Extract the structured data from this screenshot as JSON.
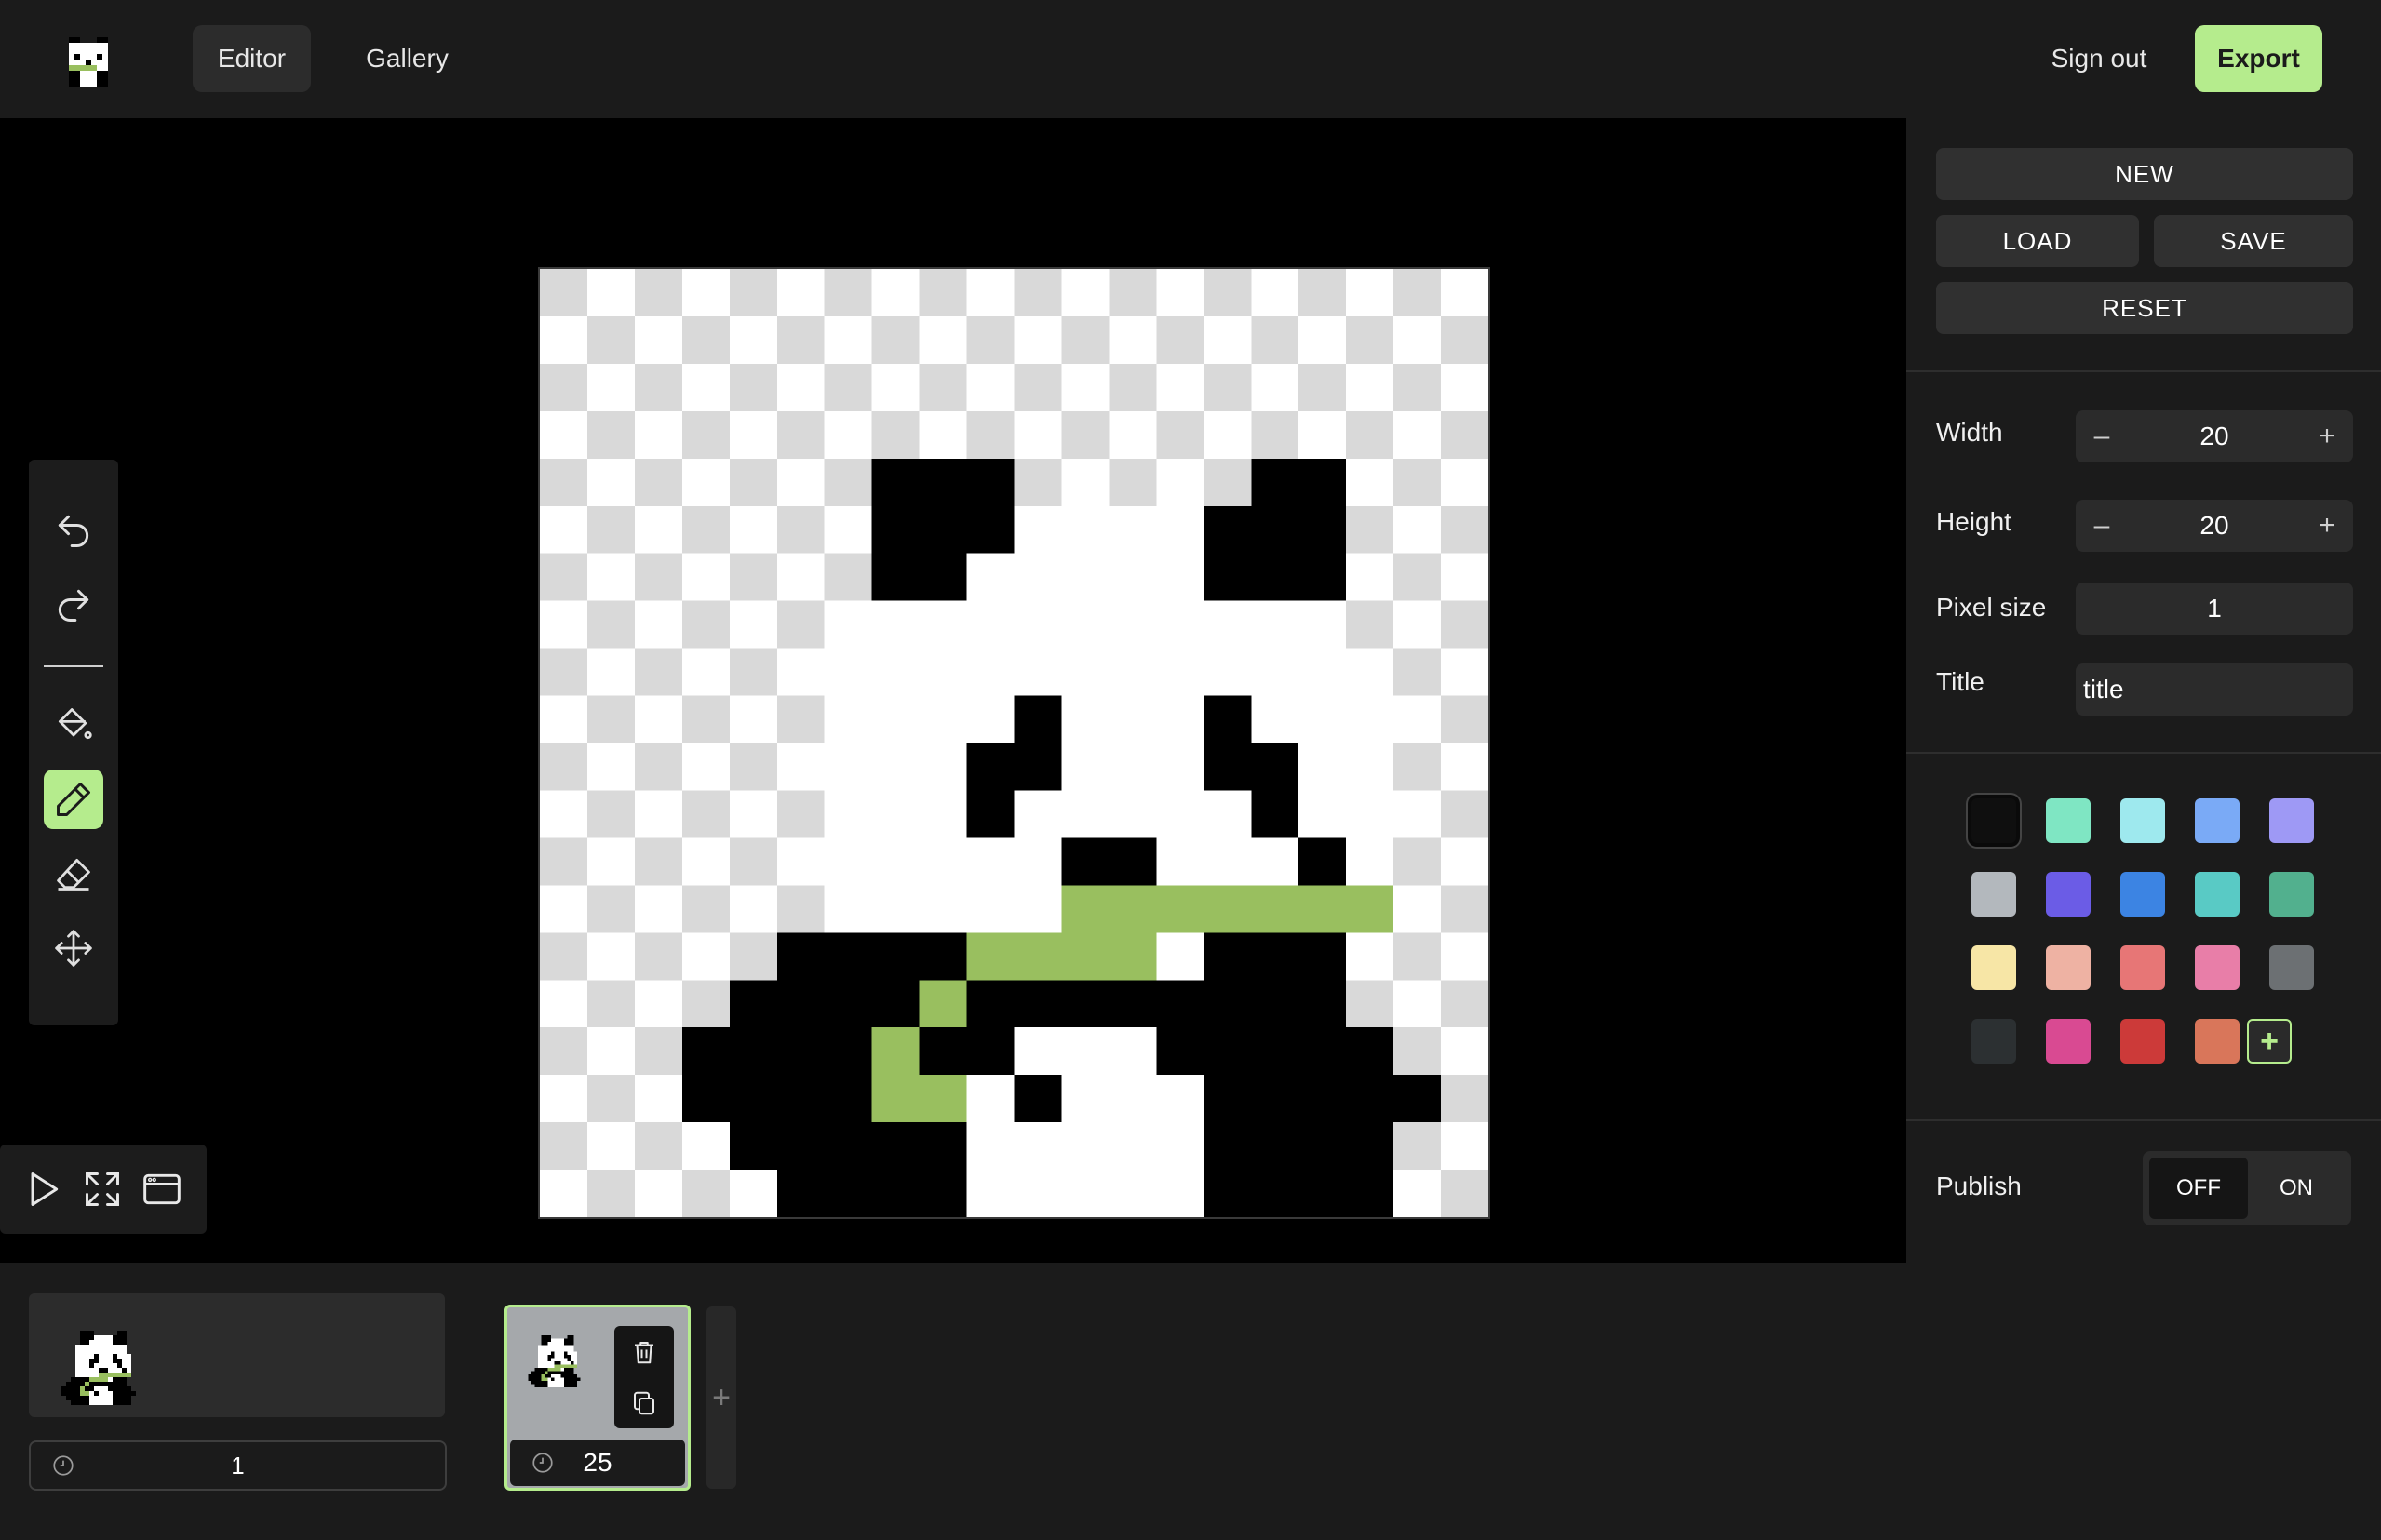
{
  "nav": {
    "logo_icon": "panda-logo-icon",
    "editor_label": "Editor",
    "gallery_label": "Gallery",
    "signout_label": "Sign out",
    "export_label": "Export"
  },
  "toolbar": {
    "tools": [
      "undo-icon",
      "redo-icon",
      "fill-bucket-icon",
      "pencil-icon",
      "eraser-icon",
      "move-icon"
    ],
    "active_tool": "pencil-icon"
  },
  "playback": {
    "buttons": [
      "play-icon",
      "fullscreen-icon",
      "window-icon"
    ]
  },
  "canvas": {
    "grid_cols": 20,
    "grid_rows": 20,
    "pixels": [
      "....................",
      "....................",
      "....................",
      "....................",
      ".......KKK.....KK...",
      ".......KKKWWWWKKK...",
      ".......KKWWWWWKKK...",
      "......WWWWWWWWWWW...",
      "......WWWWWWWWWWW...",
      "......WWWWKWWWKWWW..",
      "......WWWKKWWWKKWW..",
      "......WWWKWWWWWKWW..",
      "......WWWWWKKWWWKW..",
      "......WWWWWGGGGGGG..",
      ".....KKKKGGGGWKKK...",
      "....KKKKGKKKKKKKK...",
      "...KKKKGKKWWWKKKKK..",
      "...KKKKGGWKWWWKKKKK.",
      "....KKKKKWWWWWKKKK..",
      ".....KKKKWWWWWKKKK.."
    ],
    "colors": {
      "K": "#000000",
      "W": "#ffffff",
      "G": "#99bf5f",
      "checker_light": "#ffffff",
      "checker_dark": "#d9d9d9"
    }
  },
  "sidebar": {
    "new_label": "NEW",
    "load_label": "LOAD",
    "save_label": "SAVE",
    "reset_label": "RESET",
    "width": {
      "label": "Width",
      "value": "20",
      "minus": "–",
      "plus": "+"
    },
    "height": {
      "label": "Height",
      "value": "20",
      "minus": "–",
      "plus": "+"
    },
    "pixel_size": {
      "label": "Pixel size",
      "value": "1"
    },
    "title": {
      "label": "Title",
      "value": "title"
    },
    "palette": [
      "#0f0f0f",
      "#7fe6c3",
      "#9ee9ee",
      "#7aaaf6",
      "#9e99f5",
      "#b3b8bd",
      "#6b5ce6",
      "#3c84e3",
      "#59cac5",
      "#52b08e",
      "#f7e6a6",
      "#eeb2a3",
      "#e77676",
      "#e87ea8",
      "#6c7073",
      "#2c3032",
      "#d94a92",
      "#cc3a39",
      "#d9765a"
    ],
    "selected_color_index": 0,
    "add_color_label": "+",
    "publish": {
      "label": "Publish",
      "off_label": "OFF",
      "on_label": "ON",
      "value": "OFF"
    }
  },
  "timeline": {
    "frames": [
      {
        "duration": "1"
      },
      {
        "duration": "25",
        "selected": true
      }
    ],
    "frame_action_icons": [
      "trash-icon",
      "copy-icon"
    ],
    "add_frame_label": "+"
  }
}
